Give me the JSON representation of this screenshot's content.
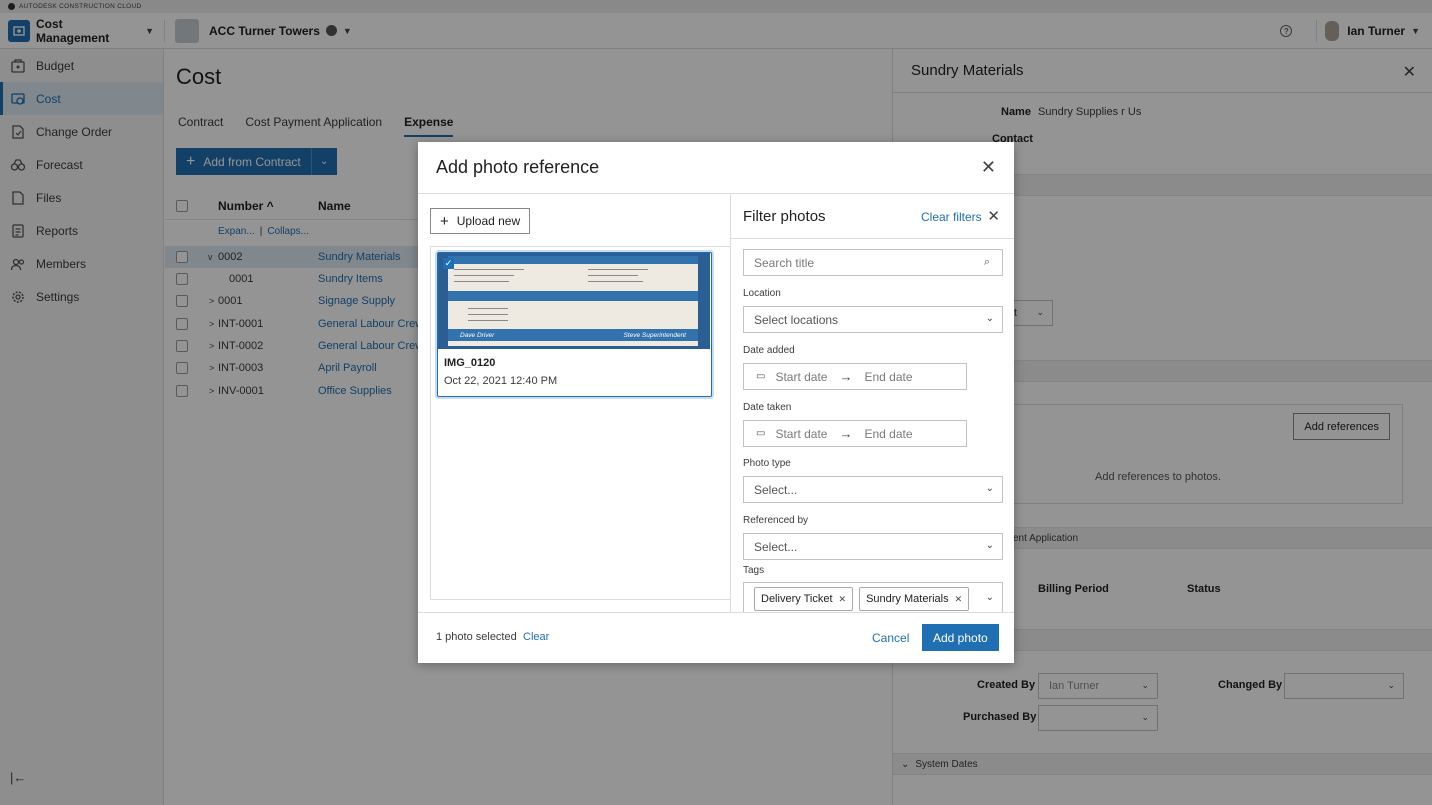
{
  "brand": {
    "text": "AUTODESK CONSTRUCTION CLOUD"
  },
  "header": {
    "module": "Cost Management",
    "project": "ACC Turner Towers",
    "user": "Ian Turner",
    "help": "?"
  },
  "sidebar": {
    "items": [
      {
        "label": "Budget",
        "icon": "budget-icon"
      },
      {
        "label": "Cost",
        "icon": "cost-icon",
        "active": true
      },
      {
        "label": "Change Order",
        "icon": "change-order-icon"
      },
      {
        "label": "Forecast",
        "icon": "forecast-icon"
      },
      {
        "label": "Files",
        "icon": "files-icon"
      },
      {
        "label": "Reports",
        "icon": "reports-icon"
      },
      {
        "label": "Members",
        "icon": "members-icon"
      },
      {
        "label": "Settings",
        "icon": "settings-icon"
      }
    ],
    "collapse": "|←"
  },
  "main": {
    "title": "Cost",
    "tabs": [
      "Contract",
      "Cost Payment Application",
      "Expense"
    ],
    "active_tab": "Expense",
    "add_button": "Add from Contract",
    "columns": {
      "number": "Number ^",
      "name": "Name"
    },
    "expand_all": "Expan...",
    "collapse_all": "Collaps...",
    "rows": [
      {
        "number": "0002",
        "name": "Sundry Materials",
        "chevron": "v"
      },
      {
        "number": "0001",
        "name": "Sundry Items",
        "chevron": ""
      },
      {
        "number": "0001",
        "name": "Signage Supply",
        "chevron": ">"
      },
      {
        "number": "INT-0001",
        "name": "General Labour Crew - M",
        "chevron": ">"
      },
      {
        "number": "INT-0002",
        "name": "General Labour Crew - A",
        "chevron": ">"
      },
      {
        "number": "INT-0003",
        "name": "April Payroll",
        "chevron": ">"
      },
      {
        "number": "INV-0001",
        "name": "Office Supplies",
        "chevron": ">"
      }
    ]
  },
  "right_panel": {
    "title": "Sundry Materials",
    "name_label": "Name",
    "name_value": "Sundry Supplies r Us",
    "contact_label": "Contact",
    "dropdown_fragment": "t",
    "add_references": "Add references",
    "references_hint": "Add references to photos.",
    "band_fragment": "ent Application",
    "billing_period": "Billing Period",
    "status": "Status",
    "created_by_label": "Created By",
    "created_by_value": "Ian Turner",
    "changed_by_label": "Changed By",
    "purchased_by_label": "Purchased By",
    "system_dates": "System Dates"
  },
  "modal": {
    "title": "Add photo reference",
    "upload": "Upload new",
    "photo": {
      "title": "IMG_0120",
      "date": "Oct 22, 2021 12:40 PM",
      "signed_a": "Dave Driver",
      "signed_b": "Steve Superintendent"
    },
    "filter": {
      "title": "Filter photos",
      "clear": "Clear filters",
      "search_placeholder": "Search title",
      "location_label": "Location",
      "location_placeholder": "Select locations",
      "date_added_label": "Date added",
      "date_taken_label": "Date taken",
      "start_date": "Start date",
      "end_date": "End date",
      "photo_type_label": "Photo type",
      "photo_type_placeholder": "Select...",
      "referenced_by_label": "Referenced by",
      "referenced_by_placeholder": "Select...",
      "tags_label": "Tags",
      "tags": [
        "Delivery Ticket",
        "Sundry Materials"
      ]
    },
    "footer": {
      "count": "1 photo selected",
      "clear": "Clear",
      "cancel": "Cancel",
      "add": "Add photo"
    }
  },
  "colors": {
    "accent": "#1f6fb2",
    "selected_row": "#dde8f3"
  }
}
